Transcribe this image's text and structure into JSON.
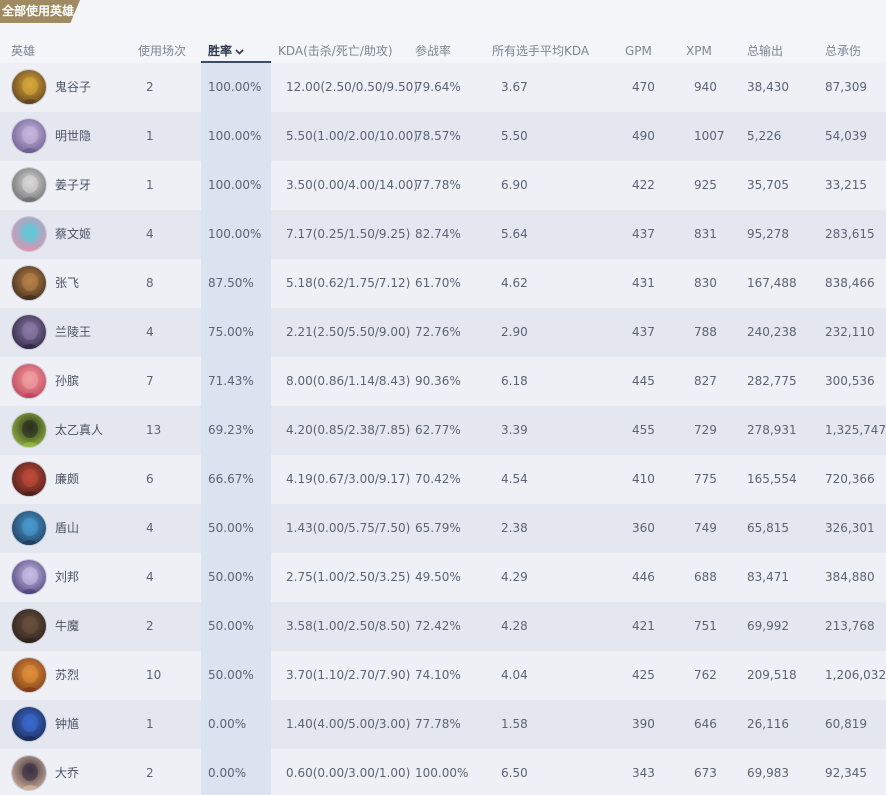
{
  "title": "全部使用英雄",
  "headers": {
    "hero": "英雄",
    "games": "使用场次",
    "winrate": "胜率",
    "kda": "KDA(击杀/死亡/助攻)",
    "participation": "参战率",
    "avg_kda": "所有选手平均KDA",
    "gpm": "GPM",
    "xpm": "XPM",
    "damage": "总输出",
    "taken": "总承伤"
  },
  "colors": {
    "title_tag": "#a08a62",
    "highlight_column": "#dbe2f0",
    "sort_underline": "#3b4a66"
  },
  "rows": [
    {
      "name": "鬼谷子",
      "games": "2",
      "winrate": "100.00%",
      "kda": "12.00(2.50/0.50/9.50)",
      "participation": "79.64%",
      "avg_kda": "3.67",
      "gpm": "470",
      "xpm": "940",
      "damage": "38,430",
      "taken": "87,309",
      "avatar": [
        "#d9a93a",
        "#5a3d1e"
      ]
    },
    {
      "name": "明世隐",
      "games": "1",
      "winrate": "100.00%",
      "kda": "5.50(1.00/2.00/10.00)",
      "participation": "78.57%",
      "avg_kda": "5.50",
      "gpm": "490",
      "xpm": "1007",
      "damage": "5,226",
      "taken": "54,039",
      "avatar": [
        "#c7b8e0",
        "#6a5a8e"
      ]
    },
    {
      "name": "姜子牙",
      "games": "1",
      "winrate": "100.00%",
      "kda": "3.50(0.00/4.00/14.00)",
      "participation": "77.78%",
      "avg_kda": "6.90",
      "gpm": "422",
      "xpm": "925",
      "damage": "35,705",
      "taken": "33,215",
      "avatar": [
        "#d8d8d8",
        "#6b6b6b"
      ]
    },
    {
      "name": "蔡文姬",
      "games": "4",
      "winrate": "100.00%",
      "kda": "7.17(0.25/1.50/9.25)",
      "participation": "82.74%",
      "avg_kda": "5.64",
      "gpm": "437",
      "xpm": "831",
      "damage": "95,278",
      "taken": "283,615",
      "avatar": [
        "#5ec8d8",
        "#e88fb0"
      ]
    },
    {
      "name": "张飞",
      "games": "8",
      "winrate": "87.50%",
      "kda": "5.18(0.62/1.75/7.12)",
      "participation": "61.70%",
      "avg_kda": "4.62",
      "gpm": "431",
      "xpm": "830",
      "damage": "167,488",
      "taken": "838,466",
      "avatar": [
        "#b8824a",
        "#3e2a1a"
      ]
    },
    {
      "name": "兰陵王",
      "games": "4",
      "winrate": "75.00%",
      "kda": "2.21(2.50/5.50/9.00)",
      "participation": "72.76%",
      "avg_kda": "2.90",
      "gpm": "437",
      "xpm": "788",
      "damage": "240,238",
      "taken": "232,110",
      "avatar": [
        "#8a7aa8",
        "#2e2540"
      ]
    },
    {
      "name": "孙膑",
      "games": "7",
      "winrate": "71.43%",
      "kda": "8.00(0.86/1.14/8.43)",
      "participation": "90.36%",
      "avg_kda": "6.18",
      "gpm": "445",
      "xpm": "827",
      "damage": "282,775",
      "taken": "300,536",
      "avatar": [
        "#f0a0a0",
        "#c0405a"
      ]
    },
    {
      "name": "太乙真人",
      "games": "13",
      "winrate": "69.23%",
      "kda": "4.20(0.85/2.38/7.85)",
      "participation": "62.77%",
      "avg_kda": "3.39",
      "gpm": "455",
      "xpm": "729",
      "damage": "278,931",
      "taken": "1,325,747",
      "avatar": [
        "#2a2e20",
        "#9ac040"
      ]
    },
    {
      "name": "廉颇",
      "games": "6",
      "winrate": "66.67%",
      "kda": "4.19(0.67/3.00/9.17)",
      "participation": "70.42%",
      "avg_kda": "4.54",
      "gpm": "410",
      "xpm": "775",
      "damage": "165,554",
      "taken": "720,366",
      "avatar": [
        "#c04a3a",
        "#4a1e18"
      ]
    },
    {
      "name": "盾山",
      "games": "4",
      "winrate": "50.00%",
      "kda": "1.43(0.00/5.75/7.50)",
      "participation": "65.79%",
      "avg_kda": "2.38",
      "gpm": "360",
      "xpm": "749",
      "damage": "65,815",
      "taken": "326,301",
      "avatar": [
        "#4a9ad0",
        "#1e3a5a"
      ]
    },
    {
      "name": "刘邦",
      "games": "4",
      "winrate": "50.00%",
      "kda": "2.75(1.00/2.50/3.25)",
      "participation": "49.50%",
      "avg_kda": "4.29",
      "gpm": "446",
      "xpm": "688",
      "damage": "83,471",
      "taken": "384,880",
      "avatar": [
        "#c8c0e8",
        "#4a3e78"
      ]
    },
    {
      "name": "牛魔",
      "games": "2",
      "winrate": "50.00%",
      "kda": "3.58(1.00/2.50/8.50)",
      "participation": "72.42%",
      "avg_kda": "4.28",
      "gpm": "421",
      "xpm": "751",
      "damage": "69,992",
      "taken": "213,768",
      "avatar": [
        "#6a5040",
        "#2a2018"
      ]
    },
    {
      "name": "苏烈",
      "games": "10",
      "winrate": "50.00%",
      "kda": "3.70(1.10/2.70/7.90)",
      "participation": "74.10%",
      "avg_kda": "4.04",
      "gpm": "425",
      "xpm": "762",
      "damage": "209,518",
      "taken": "1,206,032",
      "avatar": [
        "#e0903a",
        "#7a3a18"
      ]
    },
    {
      "name": "钟馗",
      "games": "1",
      "winrate": "0.00%",
      "kda": "1.40(4.00/5.00/3.00)",
      "participation": "77.78%",
      "avg_kda": "1.58",
      "gpm": "390",
      "xpm": "646",
      "damage": "26,116",
      "taken": "60,819",
      "avatar": [
        "#3a6ad0",
        "#1a2a50"
      ]
    },
    {
      "name": "大乔",
      "games": "2",
      "winrate": "0.00%",
      "kda": "0.60(0.00/3.00/1.00)",
      "participation": "100.00%",
      "avg_kda": "6.50",
      "gpm": "343",
      "xpm": "673",
      "damage": "69,983",
      "taken": "92,345",
      "avatar": [
        "#3a3040",
        "#d8b8a0"
      ]
    }
  ]
}
